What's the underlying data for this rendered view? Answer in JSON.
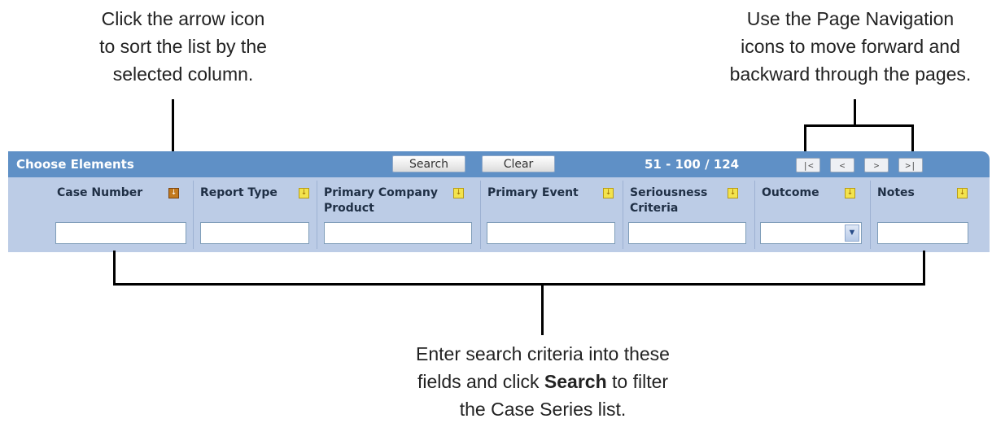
{
  "annotations": {
    "sort_note": [
      "Click the arrow icon",
      "to sort the list by the",
      "selected column."
    ],
    "nav_note": [
      "Use the Page Navigation",
      "icons to move forward and",
      "backward through the pages."
    ],
    "search_note": {
      "line1": "Enter search criteria into these",
      "line2_pre": "fields and click ",
      "line2_bold": "Search",
      "line2_post": " to filter",
      "line3": "the Case Series list."
    }
  },
  "toolbar": {
    "title": "Choose Elements",
    "search_label": "Search",
    "clear_label": "Clear",
    "page_info": "51 - 100 / 124",
    "nav": {
      "first": "|<",
      "prev": "<",
      "next": ">",
      "last": ">|"
    }
  },
  "columns": [
    {
      "label": "Case Number",
      "sort_icon": "sort-arrow-down-icon",
      "active": true
    },
    {
      "label": "Report Type",
      "sort_icon": "sort-arrow-down-icon",
      "active": false
    },
    {
      "label": "Primary Company Product",
      "sort_icon": "sort-arrow-down-icon",
      "active": false
    },
    {
      "label": "Primary Event",
      "sort_icon": "sort-arrow-down-icon",
      "active": false
    },
    {
      "label": "Seriousness Criteria",
      "sort_icon": "sort-arrow-down-icon",
      "active": false
    },
    {
      "label": "Outcome",
      "sort_icon": "sort-arrow-down-icon",
      "active": false
    },
    {
      "label": "Notes",
      "sort_icon": "sort-arrow-down-icon",
      "active": false
    }
  ],
  "colors": {
    "toolbar_bg": "#5f90c6",
    "header_bg": "#bccce6",
    "sort_icon_active": "#c2791d",
    "sort_icon_inactive": "#f3e34d"
  }
}
